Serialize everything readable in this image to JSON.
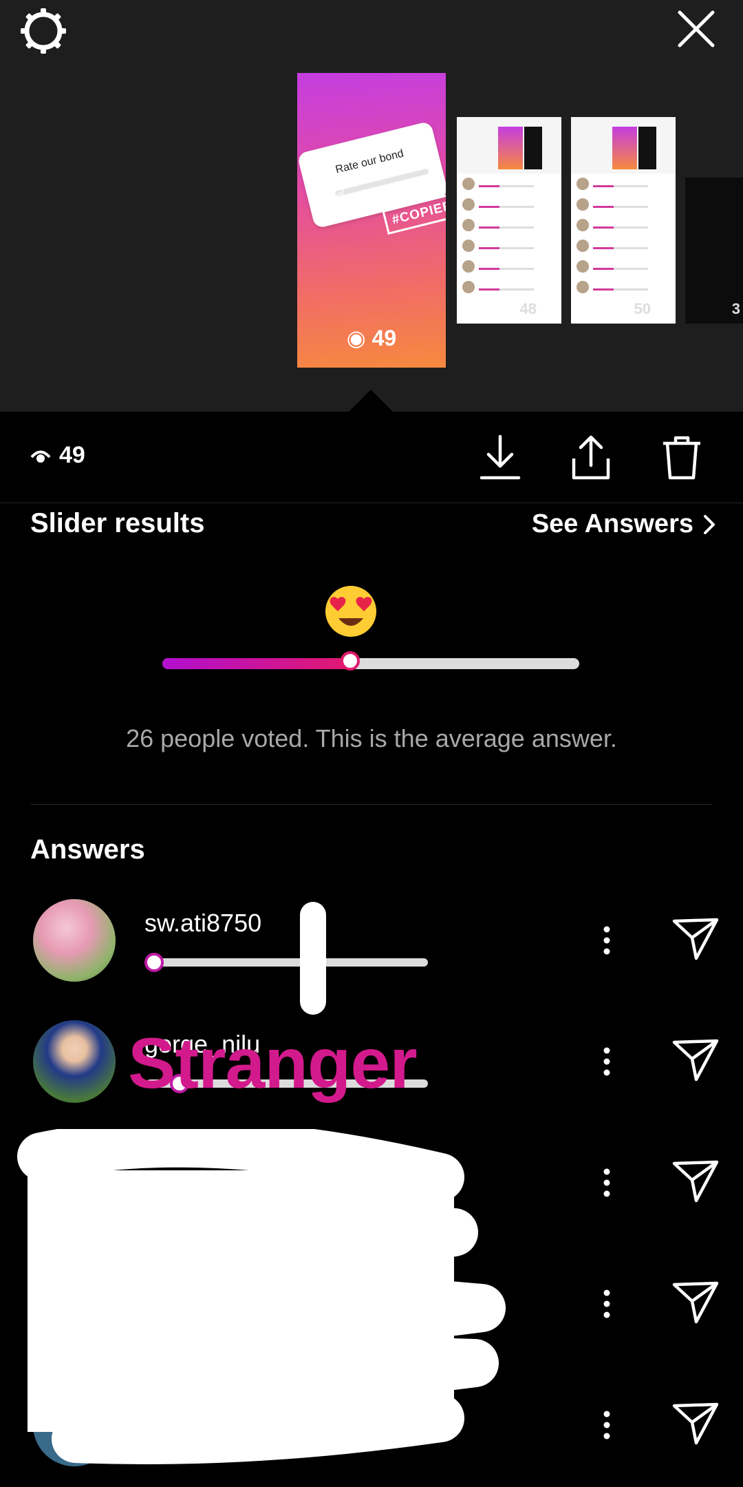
{
  "header": {
    "settings_icon": "gear-icon",
    "close_icon": "close-icon"
  },
  "story": {
    "question": "Rate our bond",
    "tag": "#COPIEE",
    "views": "49",
    "gradient_colors": [
      "#c43ee0",
      "#f7893e"
    ]
  },
  "thumbnails": [
    {
      "views": "48"
    },
    {
      "views": "50"
    },
    {
      "views": "3"
    }
  ],
  "action_bar": {
    "views": "49",
    "view_icon": "eye-icon",
    "download_icon": "download-icon",
    "share_icon": "share-icon",
    "delete_icon": "trash-icon"
  },
  "slider_results": {
    "title": "Slider results",
    "see_answers": "See Answers",
    "emoji": "heart-eyes-emoji",
    "average_fraction": 0.45,
    "caption": "26 people voted. This is the average answer."
  },
  "answers": {
    "title": "Answers",
    "items": [
      {
        "username": "sw.ati8750",
        "value": 0.03
      },
      {
        "username": "gorge_nilu",
        "value": 0.12
      }
    ],
    "overlay_text": "Stranger"
  },
  "colors": {
    "accent_pink": "#e1196e",
    "accent_purple": "#b10fd0",
    "overlay_pink": "#d21a8c",
    "background": "#000000"
  }
}
